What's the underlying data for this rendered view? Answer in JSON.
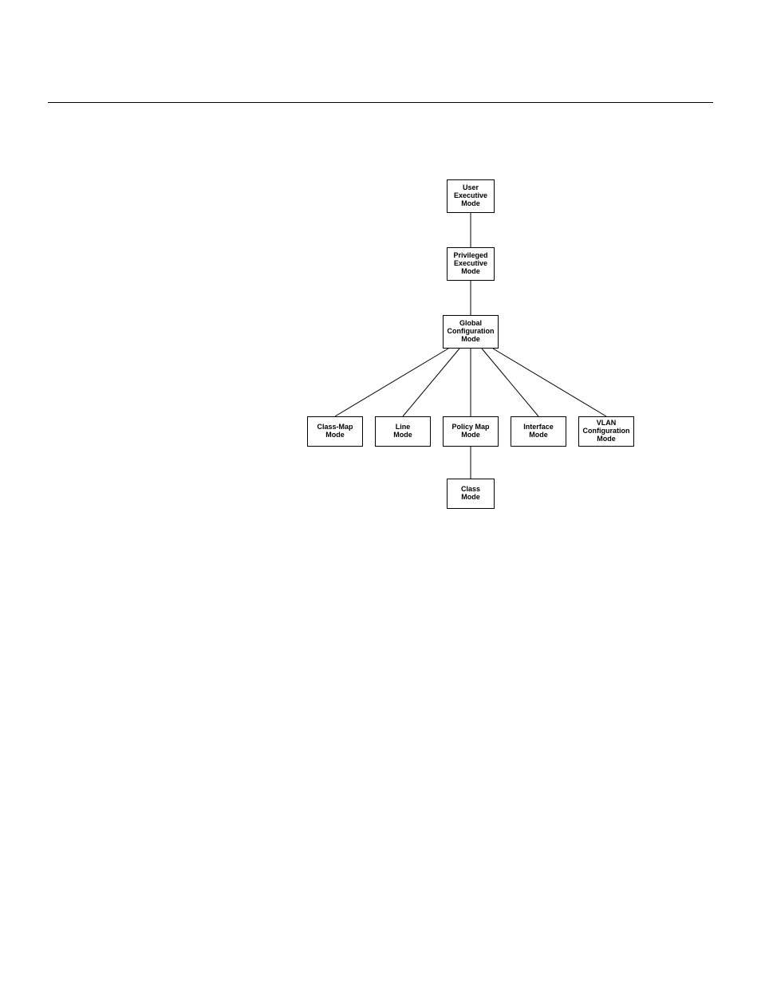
{
  "nodes": {
    "user_exec": {
      "l1": "User",
      "l2": "Executive",
      "l3": "Mode"
    },
    "priv_exec": {
      "l1": "Privileged",
      "l2": "Executive",
      "l3": "Mode"
    },
    "global_conf": {
      "l1": "Global",
      "l2": "Configuration",
      "l3": "Mode"
    },
    "class_map": {
      "l1": "Class-Map",
      "l2": "Mode"
    },
    "line": {
      "l1": "Line",
      "l2": "Mode"
    },
    "policy_map": {
      "l1": "Policy Map",
      "l2": "Mode"
    },
    "interface": {
      "l1": "Interface",
      "l2": "Mode"
    },
    "vlan_conf": {
      "l1": "VLAN",
      "l2": "Configuration",
      "l3": "Mode"
    },
    "class": {
      "l1": "Class",
      "l2": "Mode"
    }
  }
}
